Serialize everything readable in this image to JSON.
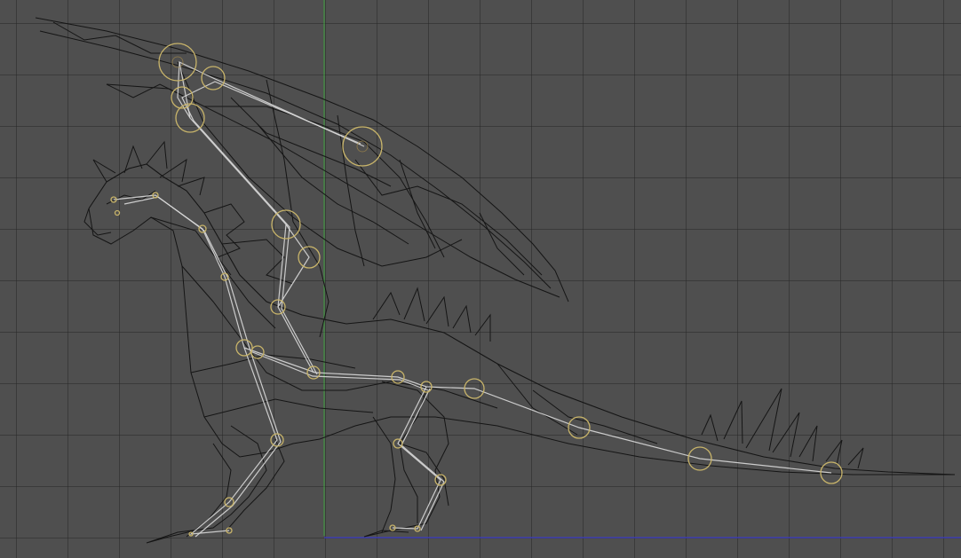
{
  "viewport": {
    "mode": "wireframe-orthographic-side",
    "colors": {
      "background": "#4f4f4f",
      "grid": "#2a2a2a",
      "mesh": "#151515",
      "bone": "#d9d9d9",
      "joint": "#c8b46a",
      "axis_y": "#3fa33f",
      "axis_x": "#3e3ec8"
    },
    "model": "dragon-wireframe-with-armature",
    "armature_joint_count": 24
  }
}
